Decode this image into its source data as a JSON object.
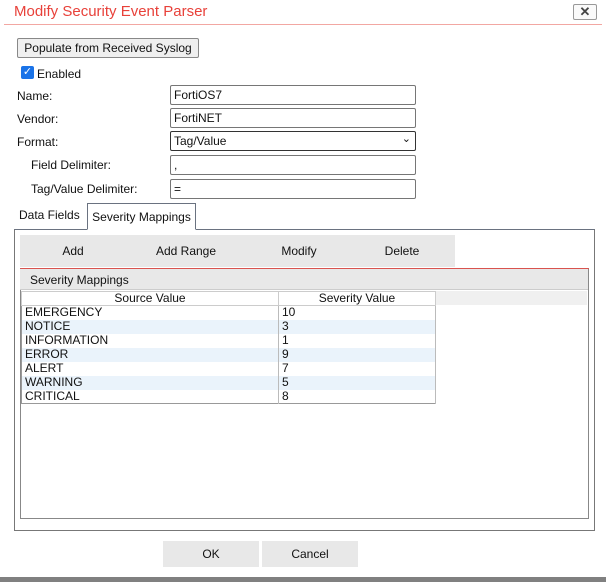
{
  "dialog": {
    "title": "Modify Security Event Parser",
    "close_label": "✕"
  },
  "form": {
    "populate_label": "Populate from Received Syslog",
    "enabled_label": "Enabled",
    "enabled": true,
    "name_label": "Name:",
    "name_value": "FortiOS7",
    "vendor_label": "Vendor:",
    "vendor_value": "FortiNET",
    "format_label": "Format:",
    "format_value": "Tag/Value",
    "field_delim_label": "Field Delimiter:",
    "field_delim_value": ",",
    "tv_delim_label": "Tag/Value Delimiter:",
    "tv_delim_value": "="
  },
  "tabs": [
    {
      "label": "Data Fields"
    },
    {
      "label": "Severity Mappings",
      "active": true
    }
  ],
  "toolbar": {
    "add": "Add",
    "add_range": "Add Range",
    "modify": "Modify",
    "delete": "Delete"
  },
  "grid": {
    "title": "Severity Mappings",
    "columns": [
      "Source Value",
      "Severity Value"
    ],
    "rows": [
      [
        "EMERGENCY",
        "10"
      ],
      [
        "NOTICE",
        "3"
      ],
      [
        "INFORMATION",
        "1"
      ],
      [
        "ERROR",
        "9"
      ],
      [
        "ALERT",
        "7"
      ],
      [
        "WARNING",
        "5"
      ],
      [
        "CRITICAL",
        "8"
      ]
    ]
  },
  "footer": {
    "ok": "OK",
    "cancel": "Cancel"
  }
}
